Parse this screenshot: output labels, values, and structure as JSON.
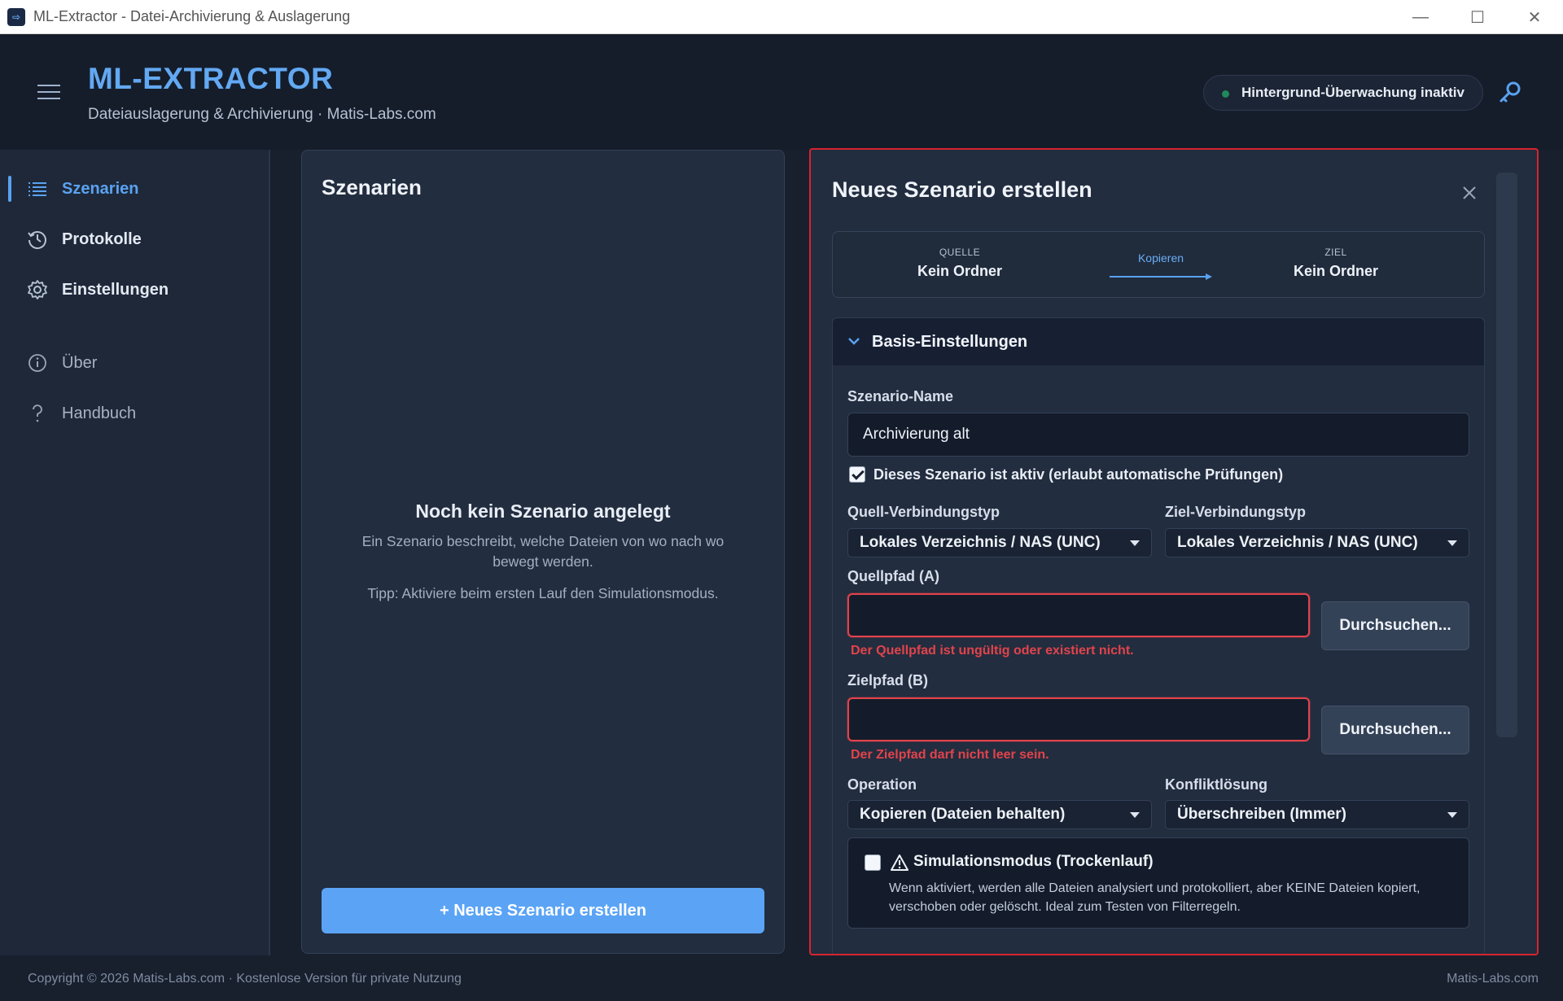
{
  "window": {
    "title": "ML-Extractor - Datei-Archivierung & Auslagerung",
    "controls": [
      "—",
      "☐",
      "✕"
    ]
  },
  "header": {
    "brand": "ML-EXTRACTOR",
    "subtitle": "Dateiauslagerung & Archivierung  ·  Matis-Labs.com",
    "status": "Hintergrund-Überwachung inaktiv",
    "status_color": "#1f8a5b"
  },
  "sidebar": {
    "items": [
      {
        "label": "Szenarien",
        "icon": "list-icon"
      },
      {
        "label": "Protokolle",
        "icon": "history-icon"
      },
      {
        "label": "Einstellungen",
        "icon": "gear-icon"
      },
      {
        "label": "Über",
        "icon": "info-icon"
      },
      {
        "label": "Handbuch",
        "icon": "help-icon"
      }
    ],
    "active": "Szenarien"
  },
  "scenarios": {
    "title": "Szenarien",
    "empty_title": "Noch kein Szenario angelegt",
    "empty_desc": "Ein Szenario beschreibt, welche Dateien von wo nach wo bewegt werden.",
    "empty_tip": "Tipp: Aktiviere beim ersten Lauf den Simulationsmodus.",
    "new_button": "+ Neues Szenario erstellen"
  },
  "editor": {
    "title": "Neues Szenario erstellen",
    "flow": {
      "source_caption": "QUELLE",
      "source_value": "Kein Ordner",
      "operation": "Kopieren",
      "target_caption": "ZIEL",
      "target_value": "Kein Ordner"
    },
    "section_title": "Basis-Einstellungen",
    "name_label": "Szenario-Name",
    "name_value": "Archivierung alt",
    "active_checkbox_label": "Dieses Szenario ist aktiv (erlaubt automatische Prüfungen)",
    "active_checked": true,
    "source_type_label": "Quell-Verbindungstyp",
    "source_type_value": "Lokales Verzeichnis / NAS (UNC)",
    "target_type_label": "Ziel-Verbindungstyp",
    "target_type_value": "Lokales Verzeichnis / NAS (UNC)",
    "source_path_label": "Quellpfad (A)",
    "source_path_value": "",
    "source_path_error": "Der Quellpfad ist ungültig oder existiert nicht.",
    "target_path_label": "Zielpfad (B)",
    "target_path_value": "",
    "target_path_error": "Der Zielpfad darf nicht leer sein.",
    "browse_label": "Durchsuchen...",
    "operation_label": "Operation",
    "operation_value": "Kopieren (Dateien behalten)",
    "conflict_label": "Konfliktlösung",
    "conflict_value": "Überschreiben (Immer)",
    "sim_title": "Simulationsmodus (Trockenlauf)",
    "sim_desc": "Wenn aktiviert, werden alle Dateien analysiert und protokolliert, aber KEINE Dateien kopiert, verschoben oder gelöscht. Ideal zum Testen von Filterregeln.",
    "sim_checked": false,
    "highlight_color": "#d8232e"
  },
  "footer": {
    "left": "Copyright © 2026 Matis-Labs.com · Kostenlose Version für private Nutzung",
    "right": "Matis-Labs.com"
  }
}
